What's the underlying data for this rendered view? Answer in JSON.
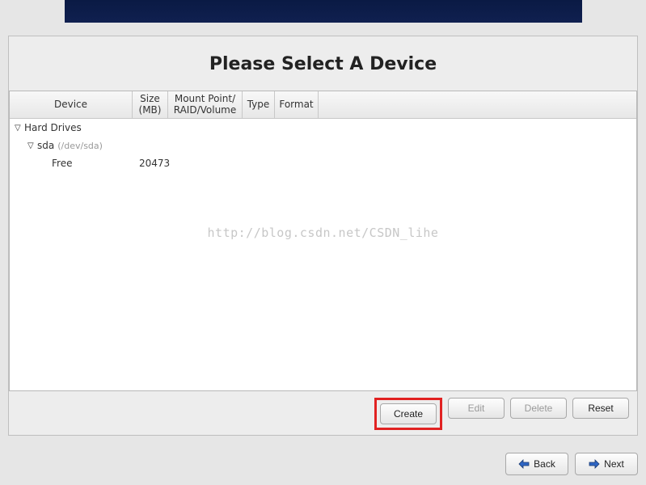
{
  "title": "Please Select A Device",
  "columns": {
    "device": "Device",
    "size": "Size\n(MB)",
    "mount": "Mount Point/\nRAID/Volume",
    "type": "Type",
    "format": "Format"
  },
  "tree": {
    "root_label": "Hard Drives",
    "drive_label": "sda",
    "drive_path": "(/dev/sda)",
    "free_label": "Free",
    "free_size": "20473"
  },
  "watermark": "http://blog.csdn.net/CSDN_lihe",
  "buttons": {
    "create": "Create",
    "edit": "Edit",
    "delete": "Delete",
    "reset": "Reset",
    "back": "Back",
    "next": "Next"
  }
}
